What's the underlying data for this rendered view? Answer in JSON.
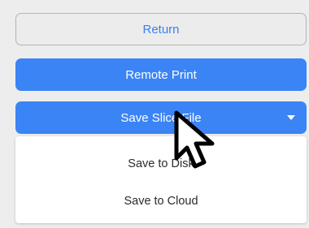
{
  "buttons": {
    "return_label": "Return",
    "remote_print_label": "Remote Print",
    "save_slice_file_label": "Save Slice File"
  },
  "save_menu": {
    "items": [
      {
        "label": "Save to Disk"
      },
      {
        "label": "Save to Cloud"
      }
    ]
  },
  "colors": {
    "accent": "#3b84f5",
    "background": "#ededed"
  },
  "icons": {
    "dropdown": "caret-down-icon",
    "pointer": "mouse-cursor-icon"
  }
}
